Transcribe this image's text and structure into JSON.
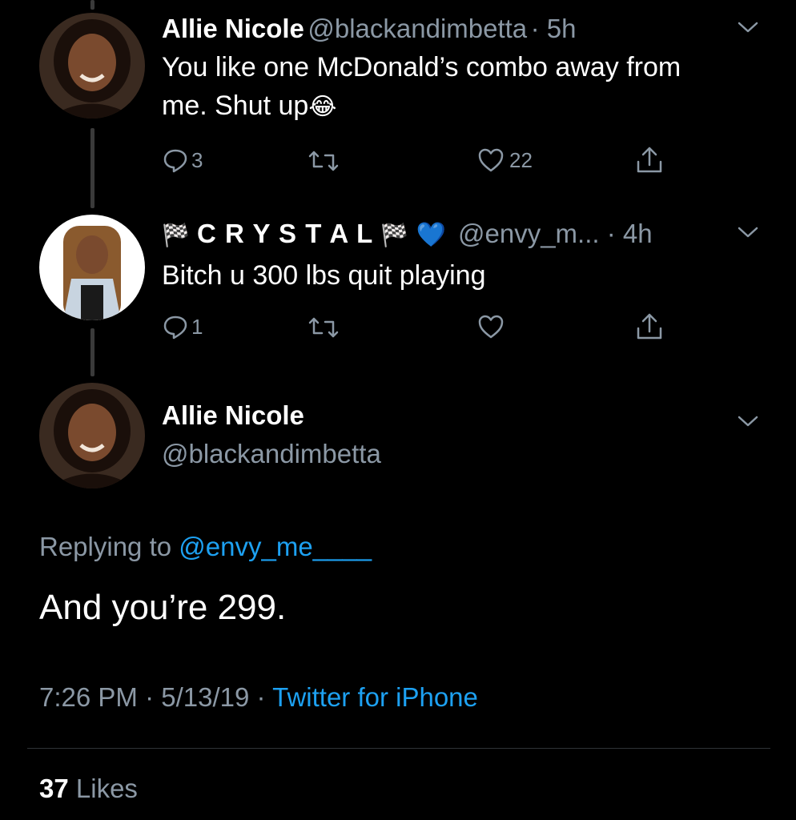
{
  "tweet1": {
    "name": "Allie Nicole",
    "handle": "@blackandimbetta",
    "time": "· 5h",
    "text_line1": "You like one McDonald’s combo away from",
    "text_line2": "me. Shut up",
    "emoji": "😂",
    "reply_count": "3",
    "retweet_count": "",
    "like_count": "22"
  },
  "tweet2": {
    "flag_left": "🏁",
    "name": "C R Y S T A L",
    "flag_right": "🏁",
    "heart_emoji": "💙",
    "handle": "@envy_m...",
    "time": "· 4h",
    "text": "Bitch u 300 lbs quit playing",
    "reply_count": "1",
    "retweet_count": "",
    "like_count": ""
  },
  "main_tweet": {
    "name": "Allie Nicole",
    "handle": "@blackandimbetta",
    "replying_prefix": "Replying to",
    "replying_to": "@envy_me____",
    "text": "And you’re 299.",
    "time": "7:26 PM",
    "date": "5/13/19",
    "sep1": "·",
    "sep2": "·",
    "source": "Twitter for iPhone",
    "likes_count": "37",
    "likes_label": "Likes"
  },
  "colors": {
    "background": "#000000",
    "muted": "#8b98a5",
    "link": "#1da1f2",
    "thread_line": "#3a3a3a"
  },
  "icons": [
    "reply-icon",
    "retweet-icon",
    "like-icon",
    "share-icon",
    "chevron-down-icon"
  ]
}
